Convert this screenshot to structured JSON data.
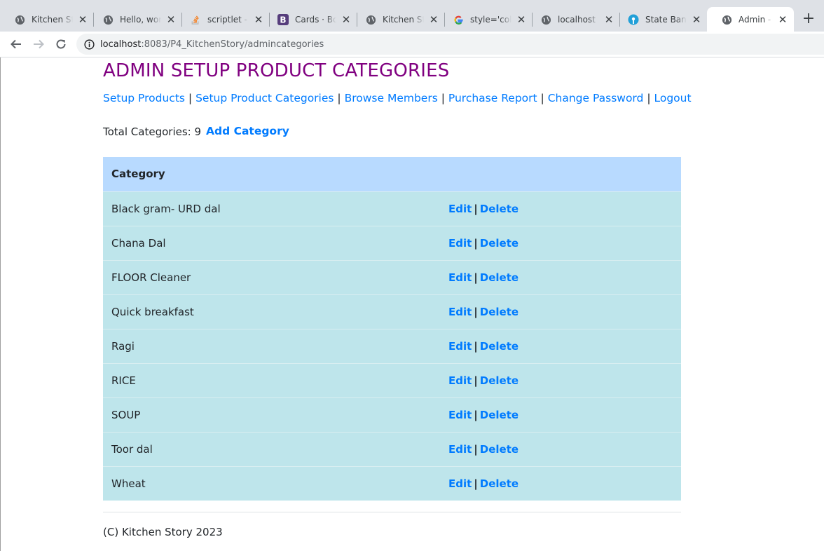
{
  "browser": {
    "tabs": [
      {
        "title": "Kitchen Story",
        "icon": "globe-icon"
      },
      {
        "title": "Hello, world!",
        "icon": "globe-icon"
      },
      {
        "title": "scriptlet - How",
        "icon": "stackoverflow-icon"
      },
      {
        "title": "Cards · Bootstrap",
        "icon": "bootstrap-icon"
      },
      {
        "title": "Kitchen Story",
        "icon": "globe-icon"
      },
      {
        "title": "style='color",
        "icon": "google-icon"
      },
      {
        "title": "localhost",
        "icon": "globe-icon"
      },
      {
        "title": "State Bank",
        "icon": "sbi-icon"
      },
      {
        "title": "Admin - Setup",
        "icon": "globe-icon",
        "active": true
      }
    ],
    "url_host": "localhost",
    "url_rest": ":8083/P4_KitchenStory/admincategories"
  },
  "page": {
    "title": "ADMIN SETUP PRODUCT CATEGORIES",
    "nav": {
      "setup_products": "Setup Products",
      "setup_categories": "Setup Product Categories",
      "browse_members": "Browse Members",
      "purchase_report": "Purchase Report",
      "change_password": "Change Password",
      "logout": "Logout",
      "separator": "|"
    },
    "total_label": "Total Categories: 9",
    "add_category": "Add Category",
    "table": {
      "header": "Category",
      "edit_label": "Edit",
      "delete_label": "Delete",
      "rows": [
        "Black gram- URD dal",
        "Chana Dal",
        "FLOOR Cleaner",
        "Quick breakfast",
        "Ragi",
        "RICE",
        "SOUP",
        "Toor dal",
        "Wheat"
      ]
    },
    "footer": "(C) Kitchen Story 2023"
  },
  "colors": {
    "title": "#800080",
    "link": "#007bff",
    "table_header_bg": "#b8daff",
    "table_row_bg": "#bee5eb"
  }
}
